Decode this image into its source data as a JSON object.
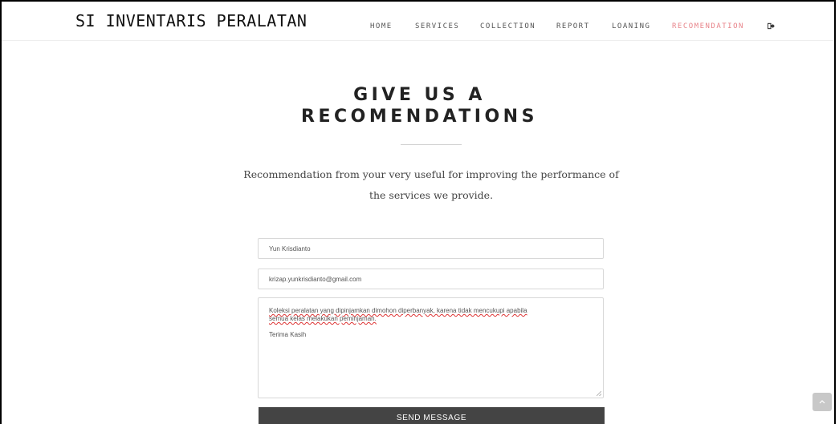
{
  "header": {
    "brand": "SI INVENTARIS PERALATAN",
    "nav": [
      {
        "label": "HOME",
        "active": false
      },
      {
        "label": "SERVICES",
        "active": false
      },
      {
        "label": "COLLECTION",
        "active": false
      },
      {
        "label": "REPORT",
        "active": false
      },
      {
        "label": "LOANING",
        "active": false
      },
      {
        "label": "RECOMENDATION",
        "active": true
      }
    ],
    "logout_icon": "logout-icon",
    "active_color": "#e8848a"
  },
  "main": {
    "title_line1": "GIVE US A",
    "title_line2": "RECOMENDATIONS",
    "subtitle_line1": "Recommendation from your very useful for improving the performance of",
    "subtitle_line2": "the services we provide.",
    "form": {
      "name_value": "Yun Krisdianto",
      "email_value": "krizap.yunkrisdianto@gmail.com",
      "message_line1": "Koleksi peralatan yang dipinjamkan dimohon diperbanyak, karena tidak mencukupi apabila",
      "message_line2": "semua kelas melakukan peminjaman.",
      "message_line3": "Terima Kasih",
      "submit_label": "SEND MESSAGE"
    }
  },
  "scroll_top_icon": "chevron-up-icon",
  "colors": {
    "button": "#444444",
    "text": "#222222"
  }
}
